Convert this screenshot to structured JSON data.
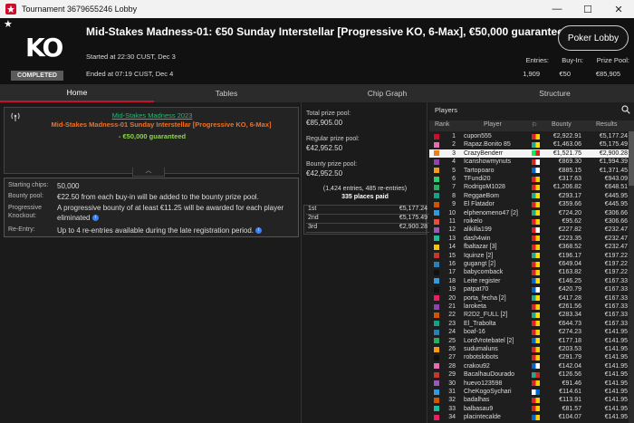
{
  "window": {
    "title": "Tournament 3679655246 Lobby"
  },
  "header": {
    "title": "Mid-Stakes Madness-01: €50 Sunday Interstellar [Progressive KO, 6-Max], €50,000 guaranteed",
    "logo_text": "KO",
    "status": "COMPLETED",
    "started": "Started at 22:30 CUST, Dec 3",
    "ended": "Ended at 07:19 CUST, Dec 4",
    "lobby_button": "Poker Lobby",
    "entries_label": "Entries:",
    "entries_value": "1,909",
    "buyin_label": "Buy-In:",
    "buyin_value": "€50",
    "prize_label": "Prize Pool:",
    "prize_value": "€85,905"
  },
  "tabs": [
    "Home",
    "Tables",
    "Chip Graph",
    "Structure"
  ],
  "home": {
    "series": "Mid-Stakes Madness 2023",
    "event": "Mid-Stakes Madness-01 Sunday Interstellar [Progressive KO, 6-Max]",
    "guarantee": "- €50,000 guaranteed",
    "collapse": "︿",
    "info": [
      {
        "label": "Starting chips:",
        "value": "50,000"
      },
      {
        "label": "Bounty pool:",
        "value": "€22.50 from each buy-in will be added to the bounty prize pool."
      },
      {
        "label": "Progressive Knockout:",
        "value": "A progressive bounty of at least €11.25 will be awarded for each player eliminated"
      },
      {
        "label": "Re-Entry:",
        "value": "Up to 4 re-entries available during the late registration period."
      }
    ],
    "info_icon": "i"
  },
  "prize": {
    "total_label": "Total prize pool:",
    "total": "€85,905.00",
    "regular_label": "Regular prize pool:",
    "regular": "€42,952.50",
    "bounty_label": "Bounty prize pool:",
    "bounty": "€42,952.50",
    "entries": "(1,424 entries, 485 re-entries)",
    "paid": "335 places paid",
    "payouts": [
      {
        "place": "1st",
        "amount": "€5,177.24"
      },
      {
        "place": "2nd",
        "amount": "€5,175.49"
      },
      {
        "place": "3rd",
        "amount": "€2,900.28"
      }
    ]
  },
  "players": {
    "title": "Players",
    "columns": [
      "Rank",
      "Player",
      "",
      "Bounty",
      "Results"
    ],
    "rows": [
      {
        "rank": "1",
        "name": "cupon555",
        "bounty": "€2,922.91",
        "result": "€5,177.24",
        "c": "#c8102e",
        "f1": "#d22",
        "f2": "#fc0"
      },
      {
        "rank": "2",
        "name": "Rapaz.Bonito 85",
        "bounty": "€1,463.06",
        "result": "€5,175.49",
        "c": "#e36fae",
        "f1": "#2a8",
        "f2": "#fd0"
      },
      {
        "rank": "3",
        "name": "CrazyBenderr",
        "bounty": "€1,521.75",
        "result": "€2,900.28",
        "c": "#e67e22",
        "f1": "#1e5",
        "f2": "#d22"
      },
      {
        "rank": "4",
        "name": "Icanshowmynuts",
        "bounty": "€869.30",
        "result": "€1,994.39",
        "c": "#8e44ad",
        "f1": "#d22",
        "f2": "#fff"
      },
      {
        "rank": "5",
        "name": "Tartopoaro",
        "bounty": "€885.15",
        "result": "€1,371.45",
        "c": "#f39c12",
        "f1": "#06c",
        "f2": "#fff"
      },
      {
        "rank": "6",
        "name": "TFundi20",
        "bounty": "€317.63",
        "result": "€943.09",
        "c": "#2ecc71",
        "f1": "#d22",
        "f2": "#fc0"
      },
      {
        "rank": "7",
        "name": "RodrigoM1028",
        "bounty": "€1,206.82",
        "result": "€648.51",
        "c": "#27ae60",
        "f1": "#d22",
        "f2": "#fc0"
      },
      {
        "rank": "8",
        "name": "ReggaeBom",
        "bounty": "€293.17",
        "result": "€445.95",
        "c": "#16a085",
        "f1": "#2a8",
        "f2": "#fd0"
      },
      {
        "rank": "9",
        "name": "El Flatador",
        "bounty": "€359.66",
        "result": "€445.95",
        "c": "#d35400",
        "f1": "#d22",
        "f2": "#fc0"
      },
      {
        "rank": "10",
        "name": "elphenomeno47 [2]",
        "bounty": "€724.20",
        "result": "€306.66",
        "c": "#3498db",
        "f1": "#2a8",
        "f2": "#fd0"
      },
      {
        "rank": "11",
        "name": "roikelo",
        "bounty": "€95.62",
        "result": "€306.66",
        "c": "#e74c3c",
        "f1": "#d22",
        "f2": "#fc0"
      },
      {
        "rank": "12",
        "name": "alikilla199",
        "bounty": "€227.82",
        "result": "€232.47",
        "c": "#9b59b6",
        "f1": "#d22",
        "f2": "#fff"
      },
      {
        "rank": "13",
        "name": "dash4win",
        "bounty": "€223.35",
        "result": "€232.47",
        "c": "#1abc9c",
        "f1": "#d22",
        "f2": "#fc0"
      },
      {
        "rank": "14",
        "name": "fbaltazar [3]",
        "bounty": "€368.52",
        "result": "€232.47",
        "c": "#f1c40f",
        "f1": "#d22",
        "f2": "#fc0"
      },
      {
        "rank": "15",
        "name": "Iquinze [2]",
        "bounty": "€196.17",
        "result": "€197.22",
        "c": "#c0392b",
        "f1": "#2a8",
        "f2": "#fd0"
      },
      {
        "rank": "16",
        "name": "gugangt [2]",
        "bounty": "€649.04",
        "result": "€197.22",
        "c": "#2980b9",
        "f1": "#d22",
        "f2": "#fc0"
      },
      {
        "rank": "17",
        "name": "babycomback",
        "bounty": "€163.82",
        "result": "€197.22",
        "c": "#111111",
        "f1": "#d22",
        "f2": "#fc0"
      },
      {
        "rank": "18",
        "name": "Leite register",
        "bounty": "€146.25",
        "result": "€167.33",
        "c": "#3498db",
        "f1": "#06c",
        "f2": "#fd0"
      },
      {
        "rank": "19",
        "name": "patpat70",
        "bounty": "€420.79",
        "result": "€167.33",
        "c": "#111111",
        "f1": "#06c",
        "f2": "#fff"
      },
      {
        "rank": "20",
        "name": "porta_fecha [2]",
        "bounty": "€417.28",
        "result": "€167.33",
        "c": "#e91e63",
        "f1": "#2a8",
        "f2": "#fd0"
      },
      {
        "rank": "21",
        "name": "laroketa",
        "bounty": "€261.56",
        "result": "€167.33",
        "c": "#8e44ad",
        "f1": "#d22",
        "f2": "#fc0"
      },
      {
        "rank": "22",
        "name": "R2D2_FULL [2]",
        "bounty": "€283.34",
        "result": "€167.33",
        "c": "#d35400",
        "f1": "#2a8",
        "f2": "#fd0"
      },
      {
        "rank": "23",
        "name": "El_Trabolta",
        "bounty": "€644.73",
        "result": "€167.33",
        "c": "#16a085",
        "f1": "#d22",
        "f2": "#fc0"
      },
      {
        "rank": "24",
        "name": "boaf-16",
        "bounty": "€274.23",
        "result": "€141.95",
        "c": "#2980b9",
        "f1": "#d22",
        "f2": "#fc0"
      },
      {
        "rank": "25",
        "name": "LordVrotebatel [2]",
        "bounty": "€177.18",
        "result": "€141.95",
        "c": "#27ae60",
        "f1": "#06c",
        "f2": "#fd0"
      },
      {
        "rank": "26",
        "name": "sudumaluns",
        "bounty": "€203.53",
        "result": "€141.95",
        "c": "#f39c12",
        "f1": "#d22",
        "f2": "#fc0"
      },
      {
        "rank": "27",
        "name": "robotslobots",
        "bounty": "€291.79",
        "result": "€141.95",
        "c": "#111111",
        "f1": "#d22",
        "f2": "#fc0"
      },
      {
        "rank": "28",
        "name": "crakou92",
        "bounty": "€142.04",
        "result": "€141.95",
        "c": "#e36fae",
        "f1": "#06c",
        "f2": "#fff"
      },
      {
        "rank": "29",
        "name": "BacalhauDourado",
        "bounty": "€126.56",
        "result": "€141.95",
        "c": "#c0392b",
        "f1": "#2a8",
        "f2": "#d22"
      },
      {
        "rank": "30",
        "name": "huevo123598",
        "bounty": "€91.46",
        "result": "€141.95",
        "c": "#9b59b6",
        "f1": "#d22",
        "f2": "#fc0"
      },
      {
        "rank": "31",
        "name": "CheKogoSychari",
        "bounty": "€114.61",
        "result": "€141.95",
        "c": "#3498db",
        "f1": "#fff",
        "f2": "#06c"
      },
      {
        "rank": "32",
        "name": "badalhas",
        "bounty": "€113.91",
        "result": "€141.95",
        "c": "#d35400",
        "f1": "#d22",
        "f2": "#fc0"
      },
      {
        "rank": "33",
        "name": "balbasau9",
        "bounty": "€81.57",
        "result": "€141.95",
        "c": "#1abc9c",
        "f1": "#d22",
        "f2": "#fc0"
      },
      {
        "rank": "34",
        "name": "placintecalde",
        "bounty": "€104.07",
        "result": "€141.95",
        "c": "#e91e63",
        "f1": "#06c",
        "f2": "#fc0"
      }
    ]
  },
  "colors": {
    "accent": "#c8102e",
    "green": "#2bb673",
    "orange": "#f36f21"
  }
}
